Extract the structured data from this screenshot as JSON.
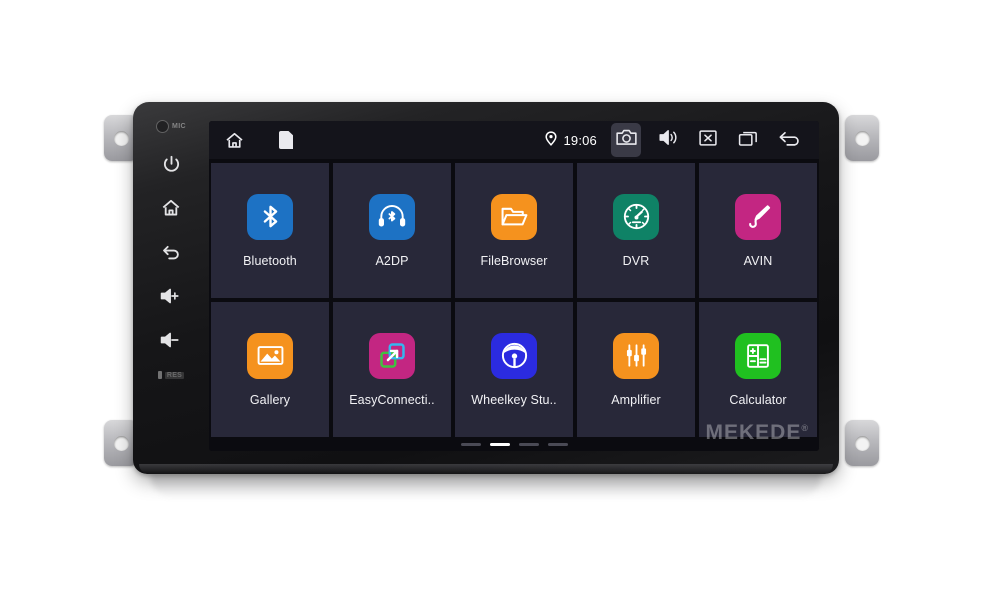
{
  "device": {
    "brand_watermark": "MEKEDE",
    "brand_watermark_mark": "®",
    "hardware_keys": [
      {
        "name": "mic",
        "label": "MIC"
      },
      {
        "name": "power",
        "label": ""
      },
      {
        "name": "home",
        "label": ""
      },
      {
        "name": "back",
        "label": ""
      },
      {
        "name": "volume-up",
        "label": ""
      },
      {
        "name": "volume-down",
        "label": ""
      },
      {
        "name": "reset",
        "label": "RES"
      }
    ]
  },
  "statusbar": {
    "home_icon": "home-icon",
    "sdcard_icon": "sdcard-icon",
    "location_icon": "location-pin-icon",
    "time": "19:06",
    "camera_icon": "camera-icon",
    "volume_icon": "volume-icon",
    "close_icon": "close-boxed-icon",
    "recents_icon": "recent-apps-icon",
    "back_icon": "back-arrow-icon"
  },
  "apps": [
    {
      "label": "Bluetooth",
      "icon": "bluetooth-icon",
      "color": "#1d72c4"
    },
    {
      "label": "A2DP",
      "icon": "headphones-icon",
      "color": "#1d72c4"
    },
    {
      "label": "FileBrowser",
      "icon": "folder-icon",
      "color": "#f5921e"
    },
    {
      "label": "DVR",
      "icon": "speedometer-icon",
      "color": "#0f8266"
    },
    {
      "label": "AVIN",
      "icon": "audio-jack-icon",
      "color": "#c32682"
    },
    {
      "label": "Gallery",
      "icon": "photo-icon",
      "color": "#f5921e"
    },
    {
      "label": "EasyConnecti..",
      "icon": "screen-mirror-icon",
      "color": "#c32682"
    },
    {
      "label": "Wheelkey Stu..",
      "icon": "steering-wheel-icon",
      "color": "#2b2be0"
    },
    {
      "label": "Amplifier",
      "icon": "equalizer-icon",
      "color": "#f5921e"
    },
    {
      "label": "Calculator",
      "icon": "calculator-icon",
      "color": "#20c020"
    }
  ],
  "pager": {
    "total": 4,
    "active_index": 1
  }
}
